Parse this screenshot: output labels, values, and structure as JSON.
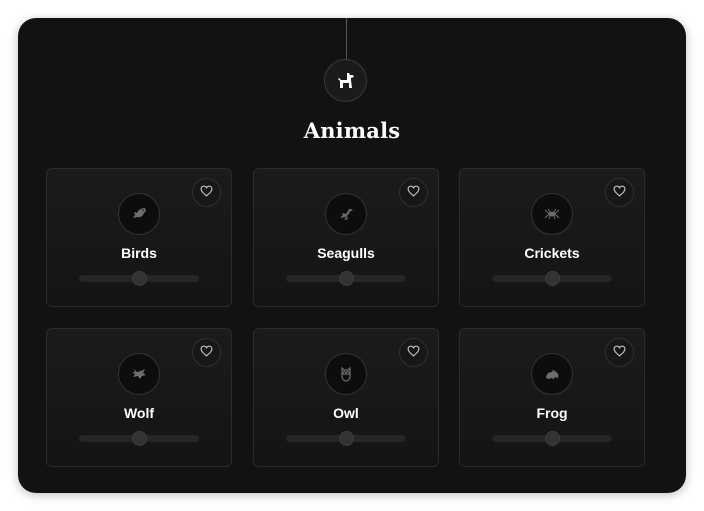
{
  "section": {
    "title": "Animals",
    "icon": "dog-icon"
  },
  "cards": [
    {
      "label": "Birds",
      "icon": "bird-icon",
      "favorited": false,
      "volume": 0.5
    },
    {
      "label": "Seagulls",
      "icon": "seagull-icon",
      "favorited": false,
      "volume": 0.5
    },
    {
      "label": "Crickets",
      "icon": "cricket-icon",
      "favorited": false,
      "volume": 0.5
    },
    {
      "label": "Wolf",
      "icon": "wolf-icon",
      "favorited": false,
      "volume": 0.5
    },
    {
      "label": "Owl",
      "icon": "owl-icon",
      "favorited": false,
      "volume": 0.5
    },
    {
      "label": "Frog",
      "icon": "frog-icon",
      "favorited": false,
      "volume": 0.5
    }
  ],
  "colors": {
    "panel_background": "#121212",
    "card_border": "#2c2c2c",
    "text": "#ffffff"
  }
}
